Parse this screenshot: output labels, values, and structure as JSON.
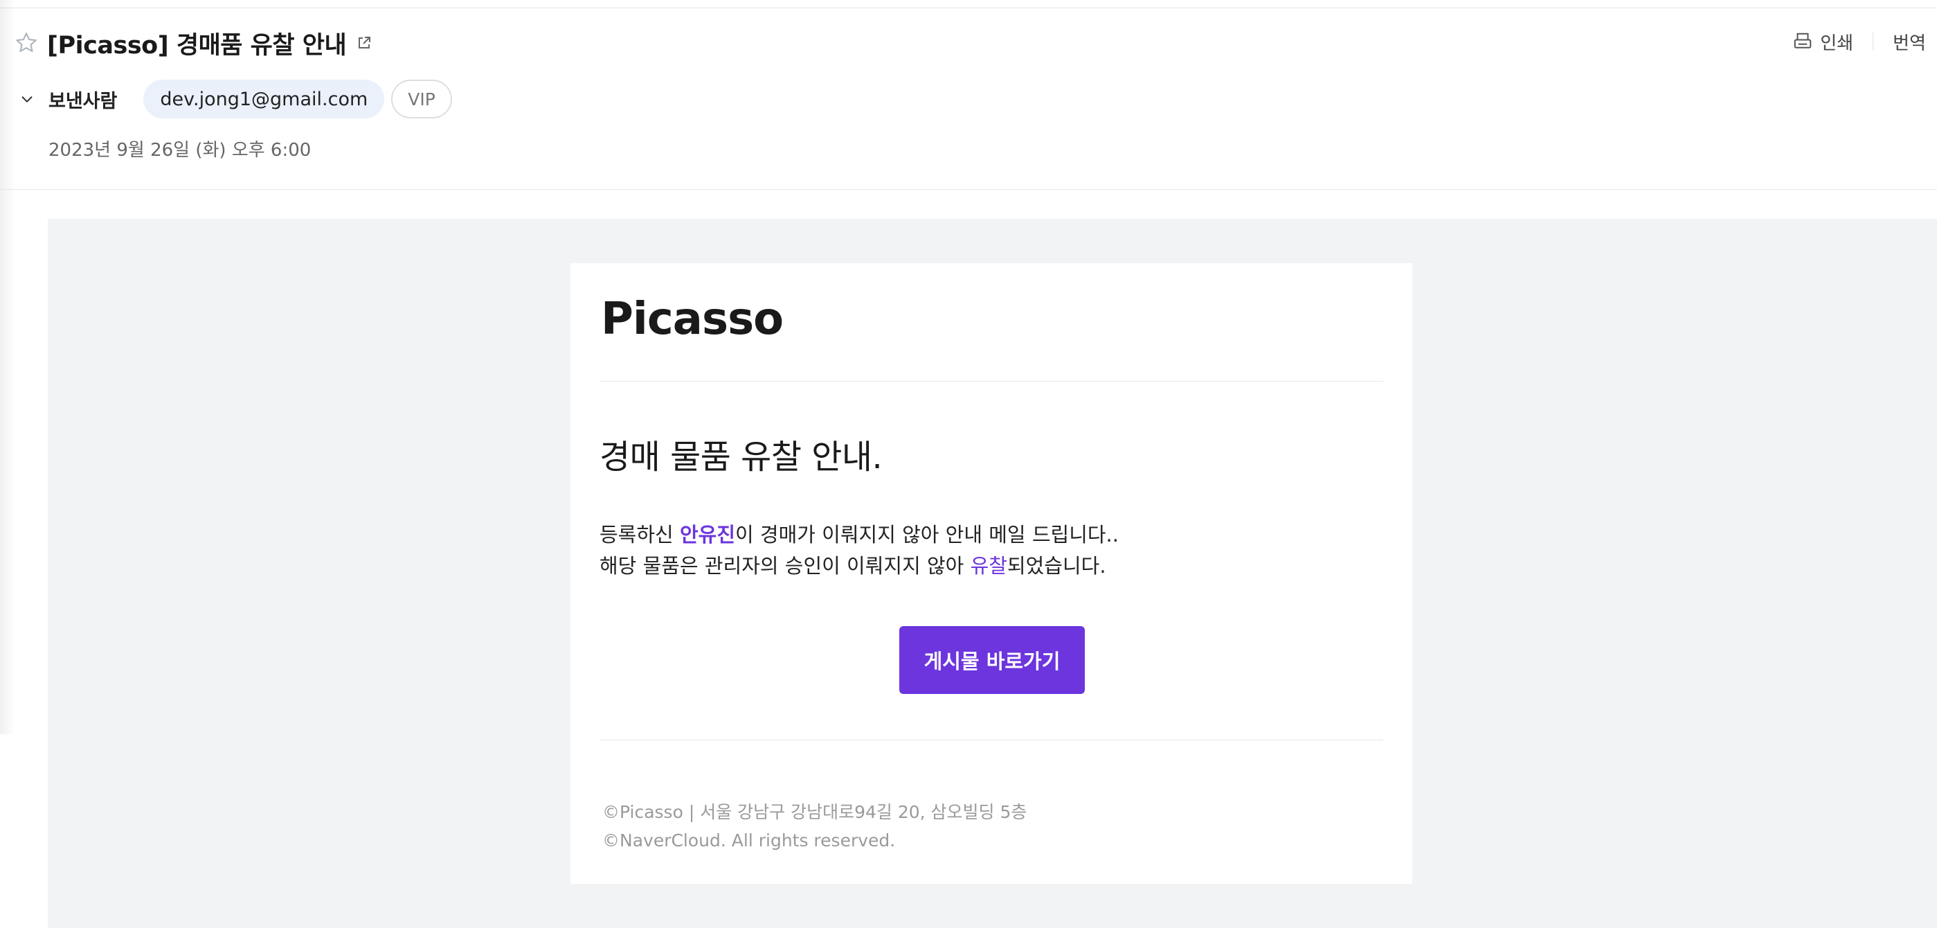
{
  "mail": {
    "subject": "[Picasso] 경매품 유찰 안내",
    "sender_label": "보낸사람",
    "sender_email": "dev.jong1@gmail.com",
    "sender_tag": "VIP",
    "date": "2023년 9월 26일 (화) 오후 6:00"
  },
  "actions": {
    "print": "인쇄",
    "translate": "번역"
  },
  "icons": {
    "star": "star-outline-icon",
    "open": "open-external-icon",
    "print": "printer-icon",
    "expand": "chevron-down-icon"
  },
  "content": {
    "logo": "Picasso",
    "title": "경매 물품 유찰 안내.",
    "line1_pre": "등록하신 ",
    "line1_name": "안유진",
    "line1_post": "이 경매가 이뤄지지 않아 안내 메일 드립니다..",
    "line2_pre": "해당 물품은 관리자의 승인이 이뤄지지 않아 ",
    "line2_hl": "유찰",
    "line2_post": "되었습니다.",
    "button": "게시물 바로가기",
    "footer1": "©Picasso | 서울 강남구 강남대로94길 20, 삼오빌딩 5층",
    "footer2": "©NaverCloud. All rights reserved."
  },
  "colors": {
    "accent": "#6c35de",
    "chip_bg": "#eaf1fb",
    "body_bg": "#f2f3f5"
  }
}
